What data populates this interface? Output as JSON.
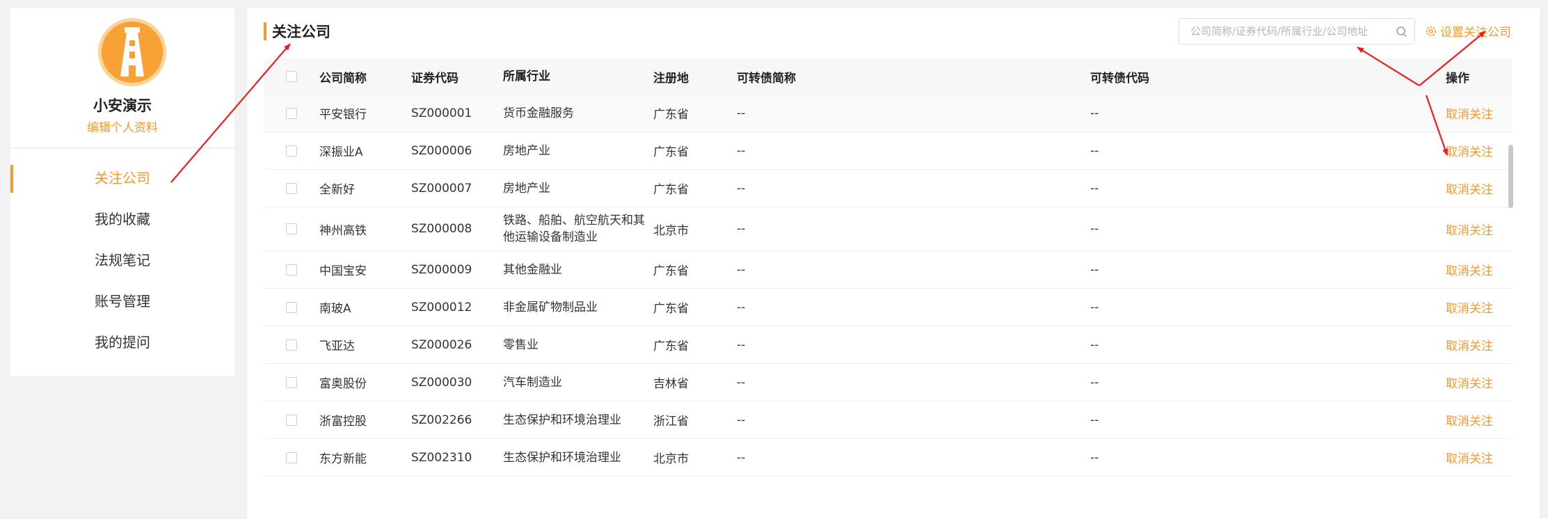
{
  "user": {
    "name": "小安演示",
    "edit_link": "编辑个人资料"
  },
  "menu": [
    {
      "label": "关注公司",
      "active": true
    },
    {
      "label": "我的收藏",
      "active": false
    },
    {
      "label": "法规笔记",
      "active": false
    },
    {
      "label": "账号管理",
      "active": false
    },
    {
      "label": "我的提问",
      "active": false
    }
  ],
  "main": {
    "title": "关注公司",
    "search_placeholder": "公司简称/证券代码/所属行业/公司地址",
    "set_follow_label": "设置关注公司"
  },
  "table": {
    "headers": [
      "公司简称",
      "证券代码",
      "所属行业",
      "注册地",
      "可转债简称",
      "可转债代码",
      "操作"
    ],
    "rows": [
      {
        "name": "平安银行",
        "code": "SZ000001",
        "industry": "货币金融服务",
        "region": "广东省",
        "cb_name": "--",
        "cb_code": "--",
        "action": "取消关注"
      },
      {
        "name": "深振业A",
        "code": "SZ000006",
        "industry": "房地产业",
        "region": "广东省",
        "cb_name": "--",
        "cb_code": "--",
        "action": "取消关注"
      },
      {
        "name": "全新好",
        "code": "SZ000007",
        "industry": "房地产业",
        "region": "广东省",
        "cb_name": "--",
        "cb_code": "--",
        "action": "取消关注"
      },
      {
        "name": "神州高铁",
        "code": "SZ000008",
        "industry": "铁路、船舶、航空航天和其他运输设备制造业",
        "region": "北京市",
        "cb_name": "--",
        "cb_code": "--",
        "action": "取消关注"
      },
      {
        "name": "中国宝安",
        "code": "SZ000009",
        "industry": "其他金融业",
        "region": "广东省",
        "cb_name": "--",
        "cb_code": "--",
        "action": "取消关注"
      },
      {
        "name": "南玻A",
        "code": "SZ000012",
        "industry": "非金属矿物制品业",
        "region": "广东省",
        "cb_name": "--",
        "cb_code": "--",
        "action": "取消关注"
      },
      {
        "name": "飞亚达",
        "code": "SZ000026",
        "industry": "零售业",
        "region": "广东省",
        "cb_name": "--",
        "cb_code": "--",
        "action": "取消关注"
      },
      {
        "name": "富奥股份",
        "code": "SZ000030",
        "industry": "汽车制造业",
        "region": "吉林省",
        "cb_name": "--",
        "cb_code": "--",
        "action": "取消关注"
      },
      {
        "name": "浙富控股",
        "code": "SZ002266",
        "industry": "生态保护和环境治理业",
        "region": "浙江省",
        "cb_name": "--",
        "cb_code": "--",
        "action": "取消关注"
      },
      {
        "name": "东方新能",
        "code": "SZ002310",
        "industry": "生态保护和环境治理业",
        "region": "北京市",
        "cb_name": "--",
        "cb_code": "--",
        "action": "取消关注"
      }
    ]
  },
  "colors": {
    "accent": "#f39a2e",
    "annotation": "#ee1c1c"
  },
  "icons": {
    "avatar": "lighthouse-logo-icon",
    "search": "search-icon",
    "settings": "gear-icon"
  }
}
